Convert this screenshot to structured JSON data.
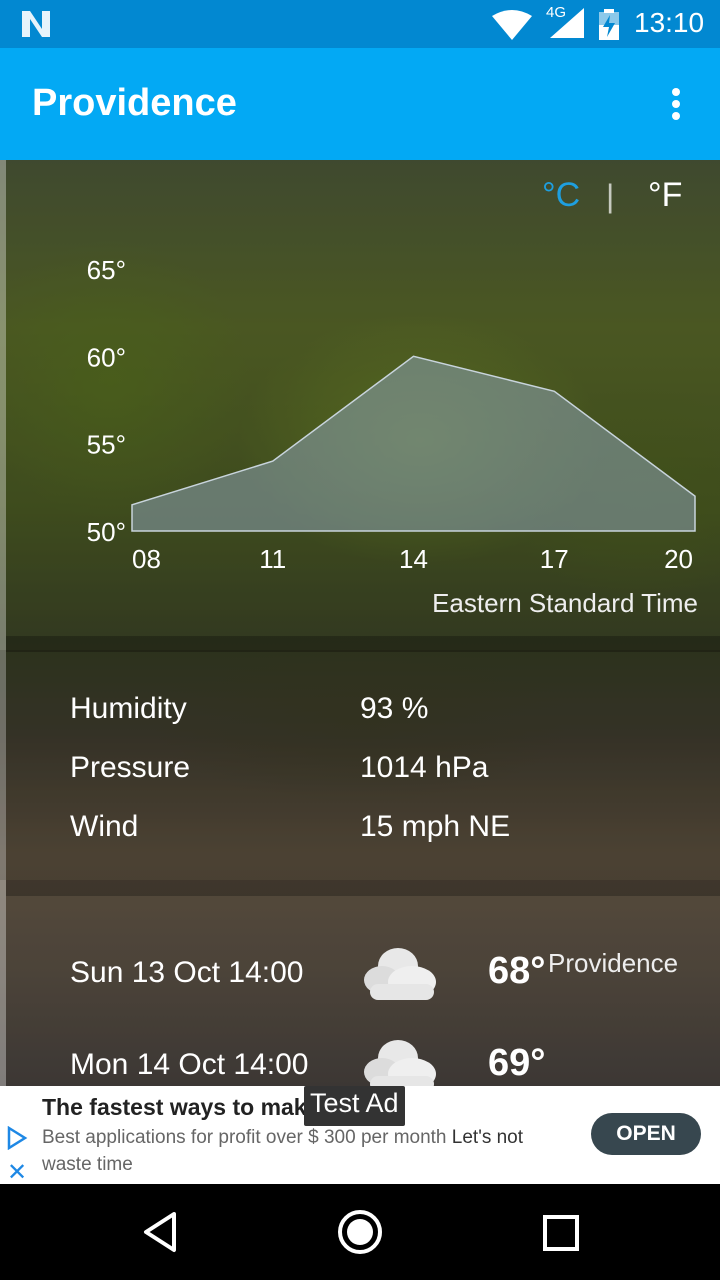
{
  "status_bar": {
    "network": "4G",
    "time": "13:10",
    "icons": [
      "notification-n-icon",
      "wifi-icon",
      "cellular-signal-icon",
      "battery-charging-icon"
    ]
  },
  "app_bar": {
    "title": "Providence",
    "menu_icon": "more-vert-icon"
  },
  "units": {
    "celsius": "°C",
    "separator": "|",
    "fahrenheit": "°F",
    "selected_color": "#1e9fe0"
  },
  "chart_data": {
    "type": "area",
    "x": [
      "08",
      "11",
      "14",
      "17",
      "20"
    ],
    "values": [
      51.5,
      54,
      60,
      58,
      52
    ],
    "y_ticks": [
      "65°",
      "60°",
      "55°",
      "50°"
    ],
    "ylim": [
      50,
      65
    ],
    "fill_color": "#8aa0b0",
    "grid": false
  },
  "timezone": "Eastern Standard Time",
  "details": [
    {
      "label": "Humidity",
      "value": "93 %"
    },
    {
      "label": "Pressure",
      "value": "1014 hPa"
    },
    {
      "label": "Wind",
      "value": "15 mph NE"
    }
  ],
  "forecast": [
    {
      "date": "Sun 13 Oct 14:00",
      "icon": "cloud-icon",
      "temp": "68°",
      "city": "Providence"
    },
    {
      "date": "Mon 14 Oct 14:00",
      "icon": "cloud-icon",
      "temp": "69°",
      "city": ""
    }
  ],
  "ad": {
    "headline": "The fastest ways to mak",
    "tag": "Test Ad",
    "body_main": "Best applications for profit over $ 300 per month",
    "body_emph": "Let's not",
    "body_tail": "waste time",
    "button": "OPEN"
  },
  "nav": {
    "back": "back-icon",
    "home": "home-icon",
    "recents": "recents-icon"
  }
}
